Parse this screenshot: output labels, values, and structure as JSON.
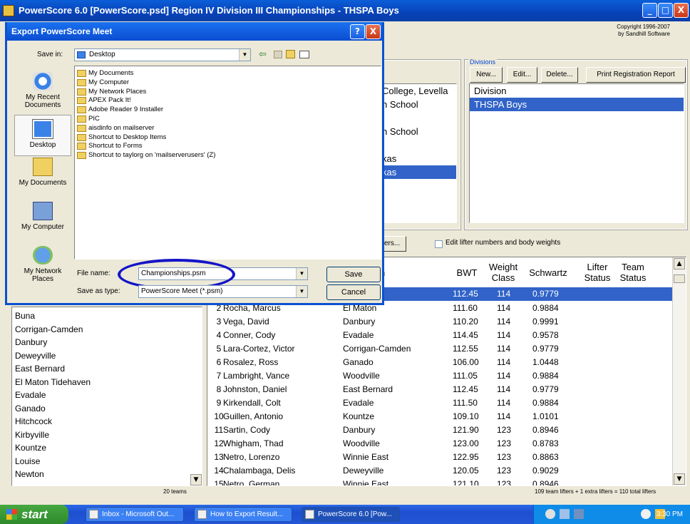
{
  "window": {
    "title": "PowerScore 6.0 [PowerScore.psd] Region IV Division III Championships - THSPA Boys",
    "min": "_",
    "max": "□",
    "close": "X",
    "copyright_line1": "Copyright 1996-2007",
    "copyright_line2": "by Sandhill Software"
  },
  "divisions": {
    "group_label": "Divisions",
    "buttons": {
      "new": "New...",
      "edit": "Edit...",
      "delete": "Delete...",
      "print": "Print Registration Report"
    },
    "list": [
      "Division",
      "THSPA Boys"
    ]
  },
  "meet_partial": {
    "rows": [
      "College, Levella",
      "n School",
      "",
      "n School",
      "",
      "kas",
      "kas"
    ]
  },
  "lifters_toolbar": {
    "button_partial": "ers...",
    "checkbox_label": "Edit lifter numbers and body weights"
  },
  "lifters": {
    "headers": {
      "team_partial": "n",
      "bwt": "BWT",
      "weight_class": "Weight Class",
      "schwartz": "Schwartz",
      "lifter_status": "Lifter Status",
      "team_status": "Team Status"
    },
    "first_row": {
      "team_partial": "e",
      "bwt": "112.45",
      "class": "114",
      "schwartz": "0.9779"
    },
    "rows": [
      {
        "num": "2",
        "name": "Rocha, Marcus",
        "team": "El Maton",
        "bwt": "111.60",
        "class": "114",
        "schwartz": "0.9884"
      },
      {
        "num": "3",
        "name": "Vega, David",
        "team": "Danbury",
        "bwt": "110.20",
        "class": "114",
        "schwartz": "0.9991"
      },
      {
        "num": "4",
        "name": "Conner, Cody",
        "team": "Evadale",
        "bwt": "114.45",
        "class": "114",
        "schwartz": "0.9578"
      },
      {
        "num": "5",
        "name": "Lara-Cortez, Victor",
        "team": "Corrigan-Camden",
        "bwt": "112.55",
        "class": "114",
        "schwartz": "0.9779"
      },
      {
        "num": "6",
        "name": "Rosalez, Ross",
        "team": "Ganado",
        "bwt": "106.00",
        "class": "114",
        "schwartz": "1.0448"
      },
      {
        "num": "7",
        "name": "Lambright, Vance",
        "team": "Woodville",
        "bwt": "111.05",
        "class": "114",
        "schwartz": "0.9884"
      },
      {
        "num": "8",
        "name": "Johnston, Daniel",
        "team": "East Bernard",
        "bwt": "112.45",
        "class": "114",
        "schwartz": "0.9779"
      },
      {
        "num": "9",
        "name": "Kirkendall, Colt",
        "team": "Evadale",
        "bwt": "111.50",
        "class": "114",
        "schwartz": "0.9884"
      },
      {
        "num": "10",
        "name": "Guillen, Antonio",
        "team": "Kountze",
        "bwt": "109.10",
        "class": "114",
        "schwartz": "1.0101"
      },
      {
        "num": "11",
        "name": "Sartin, Cody",
        "team": "Danbury",
        "bwt": "121.90",
        "class": "123",
        "schwartz": "0.8946"
      },
      {
        "num": "12",
        "name": "Whigham, Thad",
        "team": "Woodville",
        "bwt": "123.00",
        "class": "123",
        "schwartz": "0.8783"
      },
      {
        "num": "13",
        "name": "Netro, Lorenzo",
        "team": "Winnie East",
        "bwt": "122.95",
        "class": "123",
        "schwartz": "0.8863"
      },
      {
        "num": "14",
        "name": "Chalambaga, Delis",
        "team": "Deweyville",
        "bwt": "120.05",
        "class": "123",
        "schwartz": "0.9029"
      },
      {
        "num": "15",
        "name": "Netro, German",
        "team": "Winnie East",
        "bwt": "121.10",
        "class": "123",
        "schwartz": "0.8946"
      }
    ],
    "summary": "109 team lifters + 1 extra lifters = 110 total lifters"
  },
  "teams": {
    "items": [
      "Buna",
      "Corrigan-Camden",
      "Danbury",
      "Deweyville",
      "East Bernard",
      "El Maton Tidehaven",
      "Evadale",
      "Ganado",
      "Hitchcock",
      "Kirbyville",
      "Kountze",
      "Louise",
      "Newton"
    ],
    "count": "20 teams"
  },
  "dialog": {
    "title": "Export PowerScore Meet",
    "help": "?",
    "close": "X",
    "save_in_label": "Save in:",
    "save_in_value": "Desktop",
    "places": [
      "My Recent Documents",
      "Desktop",
      "My Documents",
      "My Computer",
      "My Network Places"
    ],
    "files": [
      "My Documents",
      "My Computer",
      "My Network Places",
      "APEX Pack It!",
      "Adobe Reader 9 Installer",
      "PIC",
      "aisdinfo on mailserver",
      "Shortcut to Desktop Items",
      "Shortcut to Forms",
      "Shortcut to taylorg on 'mailserverusers' (Z)"
    ],
    "file_name_label": "File name:",
    "file_name_value": "Championships.psm",
    "save_type_label": "Save as type:",
    "save_type_value": "PowerScore Meet (*.psm)",
    "save_button": "Save",
    "cancel_button": "Cancel"
  },
  "taskbar": {
    "start": "start",
    "tasks": [
      "Inbox - Microsoft Out...",
      "How to Export Result...",
      "PowerScore 6.0 [Pow..."
    ],
    "clock": "3:30 PM"
  },
  "colors": {
    "selection": "#3163c8",
    "titlebar": "#0a52d0",
    "highlight_ellipse": "#1414c8"
  }
}
